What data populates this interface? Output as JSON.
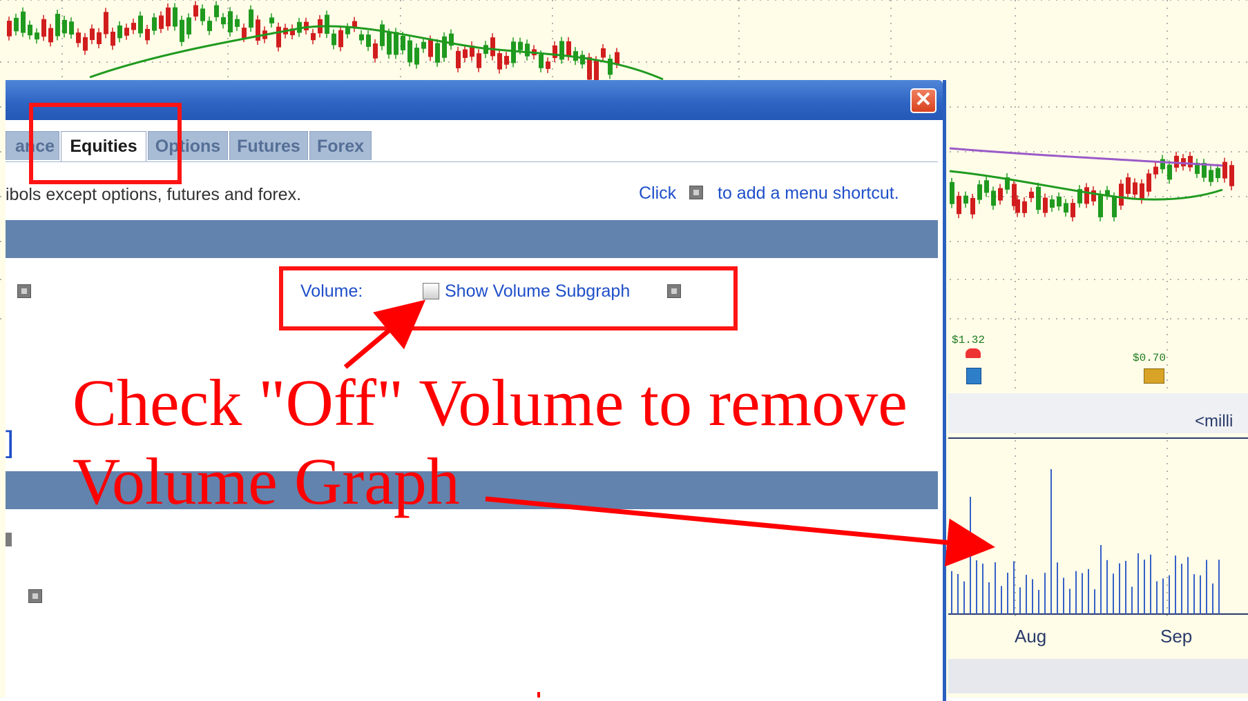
{
  "chart": {
    "dividends": [
      "$1.32",
      "$0.70"
    ],
    "volume_unit_label": "<milli",
    "months": [
      "Aug",
      "Sep"
    ],
    "colors": {
      "background": "#fffde8",
      "up": "#1f9a1f",
      "down": "#d11d1d",
      "ma_green": "#1f9a1f",
      "ma_purple": "#9a5ac8",
      "volume": "#3560c8"
    }
  },
  "dialog": {
    "close_glyph": "✕",
    "tabs": [
      {
        "label": "ance",
        "active": false
      },
      {
        "label": "Equities",
        "active": true
      },
      {
        "label": "Options",
        "active": false
      },
      {
        "label": "Futures",
        "active": false
      },
      {
        "label": "Forex",
        "active": false
      }
    ],
    "description": "ibols except options, futures and forex.",
    "shortcut_hint": {
      "prefix": "Click",
      "suffix": "to add a menu shortcut."
    },
    "volume_label": "Volume:",
    "volume_checkbox_label": "Show Volume Subgraph",
    "volume_checked": false,
    "bracket_char": "]"
  },
  "annotation": {
    "line1": "Check \"Off\" Volume to remove",
    "line2": "Volume Graph"
  },
  "colors": {
    "annotation": "#ff0000",
    "titlebar": "#2d63c2",
    "section_bar": "#6283ad",
    "link": "#1f4fc9"
  }
}
